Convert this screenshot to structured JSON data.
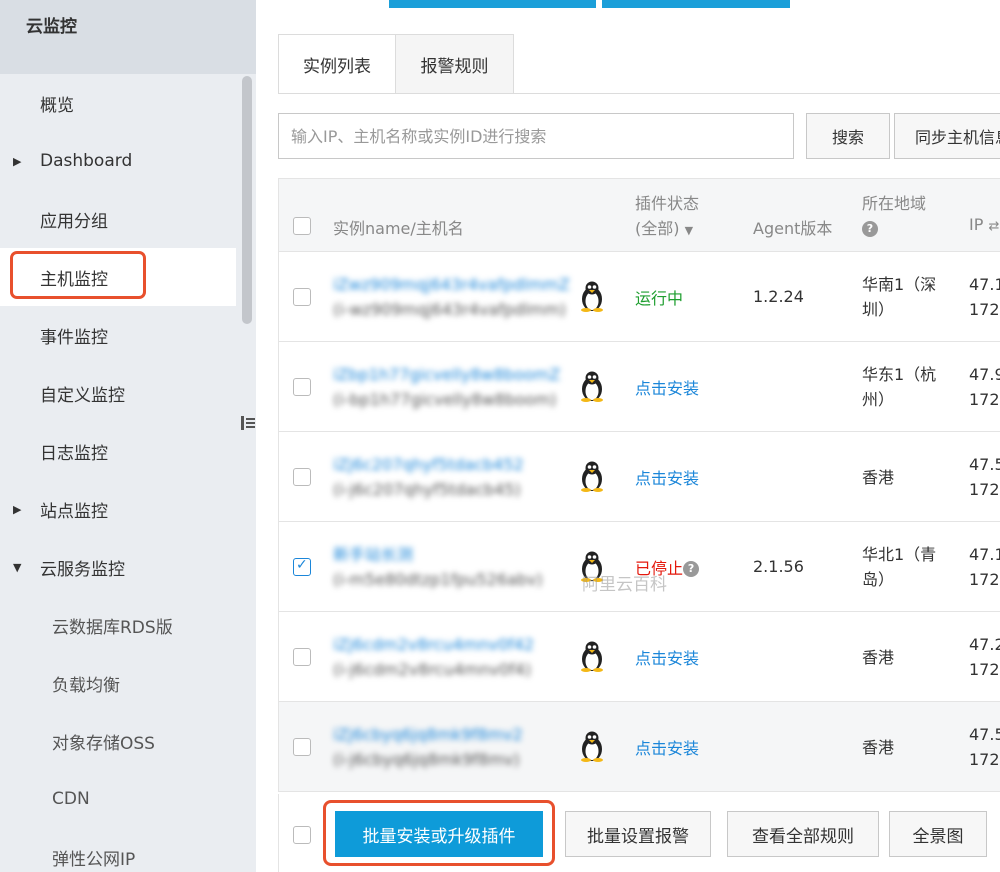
{
  "sidebar": {
    "title": "云监控",
    "items": [
      {
        "label": "概览",
        "arrow": ""
      },
      {
        "label": "Dashboard",
        "arrow": "▶"
      },
      {
        "label": "应用分组",
        "arrow": ""
      },
      {
        "label": "主机监控",
        "arrow": ""
      },
      {
        "label": "事件监控",
        "arrow": ""
      },
      {
        "label": "自定义监控",
        "arrow": ""
      },
      {
        "label": "日志监控",
        "arrow": ""
      },
      {
        "label": "站点监控",
        "arrow": "▶"
      },
      {
        "label": "云服务监控",
        "arrow": "▼"
      },
      {
        "label": "云数据库RDS版",
        "arrow": ""
      },
      {
        "label": "负载均衡",
        "arrow": ""
      },
      {
        "label": "对象存储OSS",
        "arrow": ""
      },
      {
        "label": "CDN",
        "arrow": ""
      },
      {
        "label": "弹性公网IP",
        "arrow": ""
      }
    ]
  },
  "tabs": {
    "instances": "实例列表",
    "alarm_rules": "报警规则"
  },
  "search": {
    "placeholder": "输入IP、主机名称或实例ID进行搜索",
    "search_btn": "搜索",
    "sync_btn": "同步主机信息"
  },
  "table": {
    "headers": {
      "name": "实例name/主机名",
      "plugin_status": "插件状态",
      "plugin_filter": "(全部)",
      "agent": "Agent版本",
      "region": "所在地域",
      "ip": "IP"
    },
    "rows": [
      {
        "name": "iZwz909mqj643r4vafpdlmmZ",
        "host": "(i-wz909mqj643r4vafpdlmm)",
        "status": "运行中",
        "status_type": "run",
        "agent": "1.2.24",
        "region": "华南1（深圳）",
        "ip1": "47.1",
        "ip2": "172",
        "checked": false
      },
      {
        "name": "iZbp1h77gicvelly8w8boomZ",
        "host": "(i-bp1h77gicvelly8w8boom)",
        "status": "点击安装",
        "status_type": "install",
        "agent": "",
        "region": "华东1（杭州）",
        "ip1": "47.9",
        "ip2": "172",
        "checked": false
      },
      {
        "name": "iZj6c207qhyf5tdacb452",
        "host": "(i-j6c207qhyf5tdacb45)",
        "status": "点击安装",
        "status_type": "install",
        "agent": "",
        "region": "香港",
        "ip1": "47.5",
        "ip2": "172",
        "checked": false
      },
      {
        "name": "新手站长测",
        "host": "(i-m5e80dtzp1fpu526abv)",
        "status": "已停止",
        "status_type": "stop",
        "agent": "2.1.56",
        "region": "华北1（青岛）",
        "ip1": "47.1",
        "ip2": "172",
        "checked": true
      },
      {
        "name": "iZj6cdm2v8rcu4mnv0f42",
        "host": "(i-j6cdm2v8rcu4mnv0f4)",
        "status": "点击安装",
        "status_type": "install",
        "agent": "",
        "region": "香港",
        "ip1": "47.2",
        "ip2": "172",
        "checked": false
      },
      {
        "name": "iZj6cbyq6jq8mk9f8mv2",
        "host": "(i-j6cbyq6jq8mk9f8mv)",
        "status": "点击安装",
        "status_type": "install",
        "agent": "",
        "region": "香港",
        "ip1": "47.5",
        "ip2": "172",
        "checked": false
      }
    ]
  },
  "footer": {
    "batch_install": "批量安装或升级插件",
    "batch_alarm": "批量设置报警",
    "view_rules": "查看全部规则",
    "panorama": "全景图"
  },
  "watermark": "阿里云百科"
}
